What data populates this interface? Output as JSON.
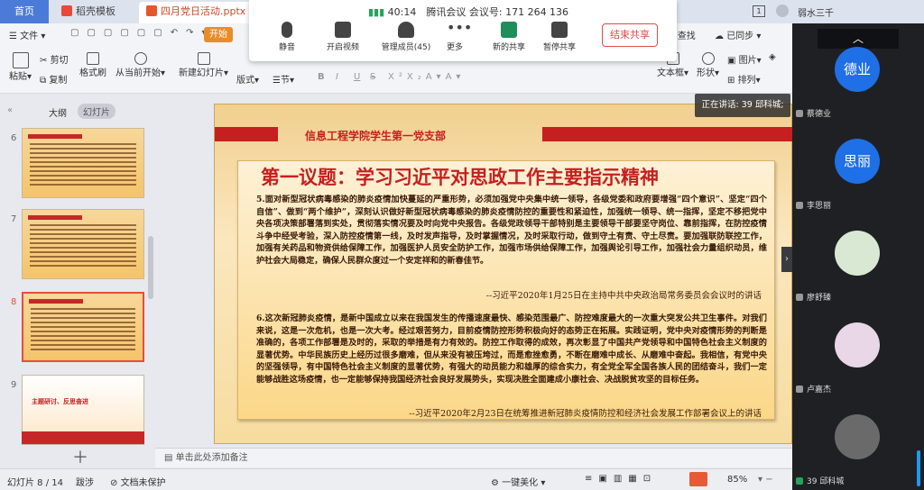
{
  "tabs": {
    "home": "首页",
    "templates": "稻壳模板",
    "doc": "四月党日活动.pptx"
  },
  "window": {
    "user": "弱水三千",
    "badge": "1"
  },
  "menu": {
    "file": "文件",
    "start": "开始",
    "search": "查找",
    "sync": "已同步"
  },
  "ribbon": {
    "paste": "粘贴",
    "cut": "剪切",
    "copy": "复制",
    "format_painter": "格式刷",
    "from_current": "从当前开始",
    "new_slide": "新建幻灯片",
    "layout": "版式",
    "section": "节",
    "textbox": "文本框",
    "shape": "形状",
    "arrange": "排列",
    "picture": "图片",
    "fill": "填充",
    "font_bold": "B",
    "font_italic": "I",
    "font_underline": "U",
    "font_strike": "S"
  },
  "meeting": {
    "time": "40:14",
    "title": "腾讯会议 会议号: 171 264 136",
    "mute": "静音",
    "video": "开启视频",
    "members": "管理成员(45)",
    "more": "更多",
    "new_share": "新的共享",
    "pause_share": "暂停共享",
    "end_share": "结束共享"
  },
  "panel": {
    "tab_outline": "大纲",
    "tab_slides": "幻灯片",
    "slides": [
      {
        "num": "6"
      },
      {
        "num": "7"
      },
      {
        "num": "8"
      },
      {
        "num": "9",
        "text": "主题研讨、反思奋进"
      }
    ]
  },
  "slide": {
    "header": "信息工程学院学生第一党支部",
    "title": "第一议题：学习习近平对思政工作主要指示精神",
    "para1": "5.面对新型冠状病毒感染的肺炎疫情加快蔓延的严重形势，必须加强党中央集中统一领导，各级党委和政府要增强“四个意识”、坚定“四个自信”、做到“两个维护”，深刻认识做好新型冠状病毒感染的肺炎疫情防控的重要性和紧迫性，加强统一领导、统一指挥，坚定不移把党中央各项决策部署落到实处，贯彻落实情况要及时向党中央报告。各级党政领导干部特别是主要领导干部要坚守岗位、靠前指挥，在防控疫情斗争中经受考验，深入防控疫情第一线，及时发声指导，及时掌握情况，及时采取行动，做到守土有责、守土尽责。要加强联防联控工作，加强有关药品和物资供给保障工作，加强医护人员安全防护工作，加强市场供给保障工作，加强舆论引导工作，加强社会力量组织动员，维护社会大局稳定，确保人民群众度过一个安定祥和的新春佳节。",
    "cite1": "--习近平2020年1月25日在主持中共中央政治局常务委员会会议时的讲话",
    "para2": "6.这次新冠肺炎疫情，是新中国成立以来在我国发生的传播速度最快、感染范围最广、防控难度最大的一次重大突发公共卫生事件。对我们来说，这是一次危机，也是一次大考。经过艰苦努力，目前疫情防控形势积极向好的态势正在拓展。实践证明，党中央对疫情形势的判断是准确的，各项工作部署是及时的，采取的举措是有力有效的。防控工作取得的成效，再次彰显了中国共产党领导和中国特色社会主义制度的显著优势。中华民族历史上经历过很多磨难，但从来没有被压垮过，而是愈挫愈勇，不断在磨难中成长、从磨难中奋起。我相信，有党中央的坚强领导，有中国特色社会主义制度的显著优势，有强大的动员能力和雄厚的综合实力，有全党全军全国各族人民的团结奋斗，我们一定能够战胜这场疫情，也一定能够保持我国经济社会良好发展势头，实现决胜全面建成小康社会、决战脱贫攻坚的目标任务。",
    "cite2": "--习近平2020年2月23日在统筹推进新冠肺炎疫情防控和经济社会发展工作部署会议上的讲话"
  },
  "notes": {
    "placeholder": "单击此处添加备注"
  },
  "status": {
    "slide_count": "幻灯片 8 / 14",
    "theme": "跋涉",
    "protect": "文档未保护",
    "beautify": "一键美化",
    "zoom": "85%"
  },
  "speaking": "正在讲话: 39 邱科城;",
  "participants": [
    {
      "avatar_text": "德业",
      "name": "蔡德业",
      "color": "#1f6fe6"
    },
    {
      "avatar_text": "思丽",
      "name": "李思丽",
      "color": "#1f6fe6"
    },
    {
      "avatar_text": "",
      "name": "廖舒臻",
      "color": "#d9e8d2"
    },
    {
      "avatar_text": "",
      "name": "卢嘉杰",
      "color": "#e9d6e6"
    },
    {
      "avatar_text": "",
      "name": "39 邱科城",
      "color": "#6a6a6a"
    }
  ]
}
